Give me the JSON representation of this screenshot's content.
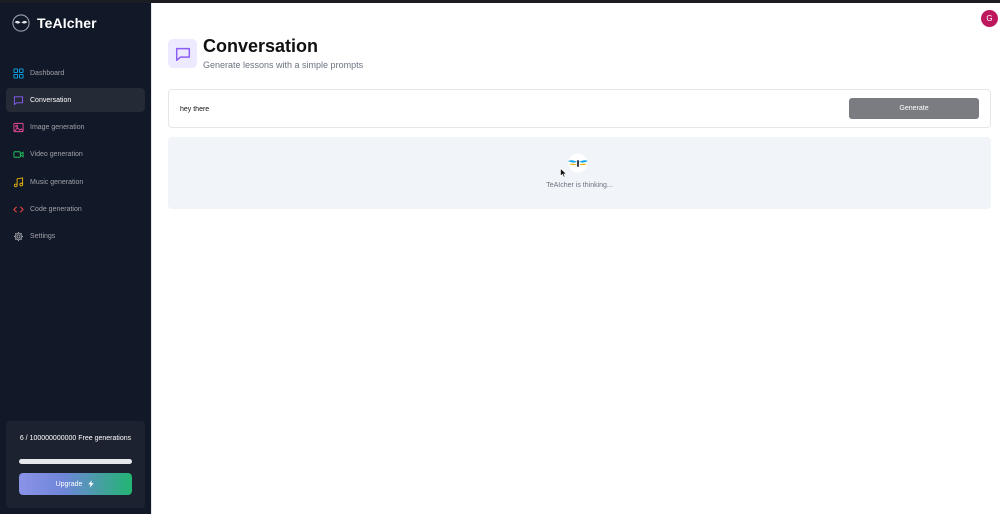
{
  "app": {
    "name": "TeAIcher"
  },
  "sidebar": {
    "items": [
      {
        "label": "Dashboard",
        "icon": "dashboard-icon",
        "color": "#0ea5e9"
      },
      {
        "label": "Conversation",
        "icon": "chat-icon",
        "color": "#8b5cf6"
      },
      {
        "label": "Image generation",
        "icon": "image-icon",
        "color": "#ec4899"
      },
      {
        "label": "Video generation",
        "icon": "video-icon",
        "color": "#22c55e"
      },
      {
        "label": "Music generation",
        "icon": "music-icon",
        "color": "#eab308"
      },
      {
        "label": "Code generation",
        "icon": "code-icon",
        "color": "#ef4444"
      },
      {
        "label": "Settings",
        "icon": "gear-icon",
        "color": "#a1a1aa"
      }
    ],
    "active_index": 1,
    "usage": {
      "text": "6 / 100000000000 Free generations",
      "progress_fraction": 6e-11
    },
    "upgrade_label": "Upgrade"
  },
  "header": {
    "avatar_initial": "G",
    "title": "Conversation",
    "subtitle": "Generate lessons with a simple prompts"
  },
  "prompt": {
    "value": "hey there",
    "generate_label": "Generate"
  },
  "status": {
    "thinking_text": "TeAIcher is thinking..."
  },
  "colors": {
    "sidebar_bg": "#111827",
    "accent": "#8b5cf6",
    "generate_button": "#7b7c82",
    "avatar": "#be185d"
  }
}
